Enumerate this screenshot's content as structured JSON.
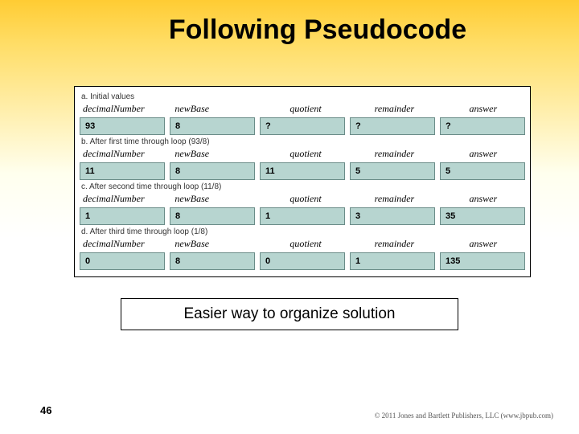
{
  "title": "Following Pseudocode",
  "caption": "Easier way to organize solution",
  "page_number": "46",
  "copyright": "© 2011 Jones and Bartlett Publishers, LLC (www.jbpub.com)",
  "headers": {
    "c1": "decimalNumber",
    "c2": "newBase",
    "c3": "quotient",
    "c4": "remainder",
    "c5": "answer"
  },
  "sections": [
    {
      "label": "a.  Initial values",
      "vals": {
        "c1": "93",
        "c2": "8",
        "c3": "?",
        "c4": "?",
        "c5": "?"
      }
    },
    {
      "label": "b.  After first time through loop (93/8)",
      "vals": {
        "c1": "11",
        "c2": "8",
        "c3": "11",
        "c4": "5",
        "c5": "5"
      }
    },
    {
      "label": "c.  After second time through loop (11/8)",
      "vals": {
        "c1": "1",
        "c2": "8",
        "c3": "1",
        "c4": "3",
        "c5": "35"
      }
    },
    {
      "label": "d.  After third time through loop (1/8)",
      "vals": {
        "c1": "0",
        "c2": "8",
        "c3": "0",
        "c4": "1",
        "c5": "135"
      }
    }
  ],
  "chart_data": {
    "type": "table",
    "title": "Following Pseudocode — base conversion trace (decimal 93 to base 8)",
    "columns": [
      "decimalNumber",
      "newBase",
      "quotient",
      "remainder",
      "answer"
    ],
    "rows": [
      {
        "step": "Initial values",
        "decimalNumber": 93,
        "newBase": 8,
        "quotient": "?",
        "remainder": "?",
        "answer": "?"
      },
      {
        "step": "After first time through loop (93/8)",
        "decimalNumber": 11,
        "newBase": 8,
        "quotient": 11,
        "remainder": 5,
        "answer": "5"
      },
      {
        "step": "After second time through loop (11/8)",
        "decimalNumber": 1,
        "newBase": 8,
        "quotient": 1,
        "remainder": 3,
        "answer": "35"
      },
      {
        "step": "After third time through loop (1/8)",
        "decimalNumber": 0,
        "newBase": 8,
        "quotient": 0,
        "remainder": 1,
        "answer": "135"
      }
    ]
  }
}
